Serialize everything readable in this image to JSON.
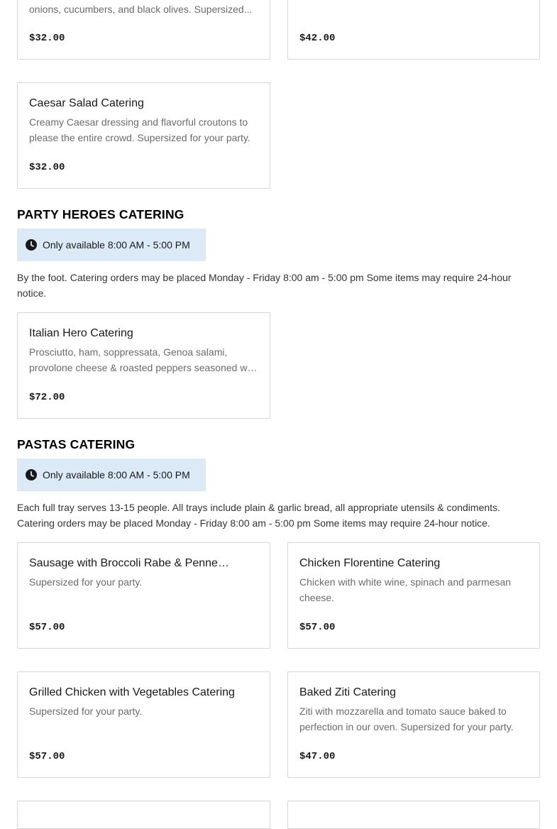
{
  "salads_continued": {
    "card_left": {
      "desc": "onions, cucumbers, and black olives. Supersized...",
      "price": "$32.00"
    },
    "card_right": {
      "price": "$42.00"
    },
    "caesar": {
      "title": "Caesar Salad Catering",
      "desc": "Creamy Caesar dressing and flavorful croutons to please the entire crowd. Supersized for your party.",
      "price": "$32.00"
    }
  },
  "party_heroes": {
    "title": "PARTY HEROES CATERING",
    "availability": "Only available 8:00 AM - 5:00 PM",
    "description": "By the foot. Catering orders may be placed Monday - Friday 8:00 am - 5:00 pm Some items may require 24-hour notice.",
    "items": [
      {
        "title": "Italian Hero Catering",
        "desc": "Prosciutto, ham, soppressata, Genoa salami, provolone cheese & roasted peppers seasoned with oil and vinegar.",
        "price": "$72.00"
      }
    ]
  },
  "pastas": {
    "title": "PASTAS CATERING",
    "availability": "Only available 8:00 AM - 5:00 PM",
    "description": "Each full tray serves 13-15 people. All trays include plain & garlic bread, all appropriate utensils & condiments. Catering orders may be placed Monday - Friday 8:00 am - 5:00 pm Some items may require 24-hour notice.",
    "items": [
      {
        "title": "Sausage with Broccoli Rabe & Penne Catering",
        "desc": "Supersized for your party.",
        "price": "$57.00"
      },
      {
        "title": "Chicken Florentine Catering",
        "desc": "Chicken with white wine, spinach and parmesan cheese.",
        "price": "$57.00"
      },
      {
        "title": "Grilled Chicken with Vegetables Catering",
        "desc": "Supersized for your party.",
        "price": "$57.00"
      },
      {
        "title": "Baked Ziti Catering",
        "desc": "Ziti with mozzarella and tomato sauce baked to perfection in our oven. Supersized for your party.",
        "price": "$47.00"
      }
    ]
  },
  "icons": {
    "availability": "clock-icon"
  },
  "colors": {
    "badge_bg": "#dceaf8",
    "border": "#d6d6d6",
    "muted_text": "#6b6b6b"
  }
}
